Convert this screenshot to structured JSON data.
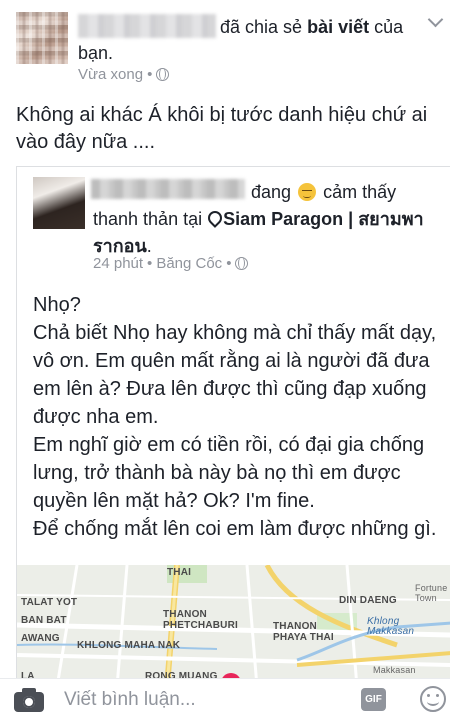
{
  "notification": {
    "action_text": "đã chia sẻ",
    "object_text": "bài viết",
    "suffix_text": "của bạn.",
    "time": "Vừa xong",
    "time_separator": "•"
  },
  "post": {
    "text": "Không ai khác Á khôi bị tước danh hiệu chứ ai vào đây nữa  ...."
  },
  "shared_post": {
    "feeling_prefix": "đang",
    "feeling_text": "cảm thấy thanh thản tại",
    "location": "Siam Paragon | สยามพารากอน",
    "location_suffix": ".",
    "time": "24 phút",
    "place": "Băng Cốc",
    "separator": "•",
    "body": [
      "Nhọ?",
      "Chả biết Nhọ hay không mà chỉ thấy mất dạy, vô ơn. Em quên mất rằng ai là người đã đưa em lên à? Đưa lên được thì cũng đạp xuống được nha em.",
      "Em nghĩ giờ em có tiền rồi, có đại gia chống lưng, trở thành bà này bà nọ thì em được quyền lên mặt hả? Ok? I'm fine.",
      "Để chống mắt lên coi em làm được những gì."
    ]
  },
  "map": {
    "labels": [
      "THAI",
      "TALAT YOT",
      "BAN BAT",
      "AWANG",
      "KHLONG MAHA NAK",
      "THANON PHETCHABURI",
      "THANON PHAYA THAI",
      "DIN DAENG",
      "Fortune Town",
      "Khlong Makkasan",
      "Makkasan",
      "RONG MUANG",
      "LA"
    ]
  },
  "comment_bar": {
    "placeholder": "Viết bình luận...",
    "gif_label": "GIF"
  }
}
